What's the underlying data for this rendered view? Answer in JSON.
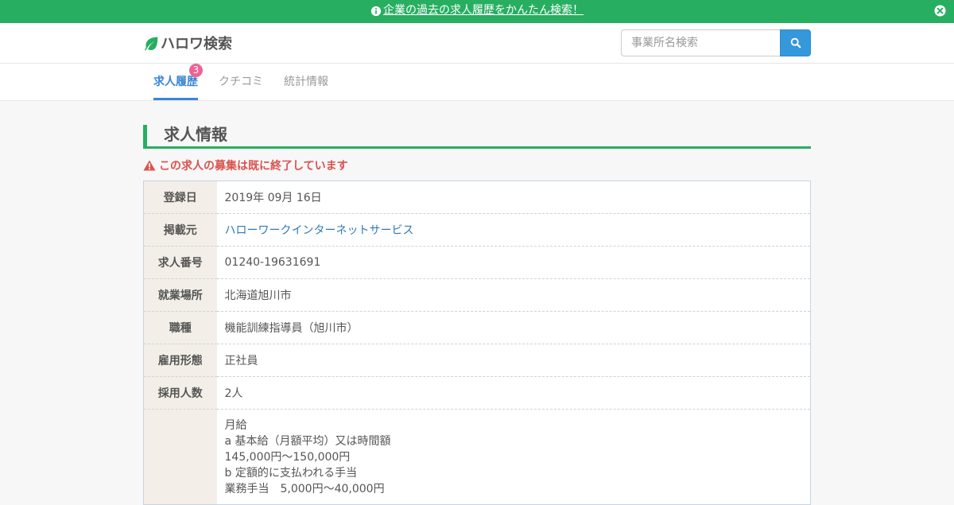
{
  "notice": {
    "link_text": "企業の過去の求人履歴をかんたん検索！"
  },
  "header": {
    "logo_text": "ハロワ検索",
    "search_placeholder": "事業所名検索"
  },
  "tabs": [
    {
      "label": "求人履歴",
      "active": true,
      "badge": "3"
    },
    {
      "label": "クチコミ",
      "active": false
    },
    {
      "label": "統計情報",
      "active": false
    }
  ],
  "section": {
    "title": "求人情報",
    "alert": "この求人の募集は既に終了しています"
  },
  "rows": [
    {
      "label": "登録日",
      "value": "2019年 09月 16日"
    },
    {
      "label": "掲載元",
      "value": "ハローワークインターネットサービス"
    },
    {
      "label": "求人番号",
      "value": "01240-19631691"
    },
    {
      "label": "就業場所",
      "value": "北海道旭川市"
    },
    {
      "label": "職種",
      "value": "機能訓練指導員（旭川市）"
    },
    {
      "label": "雇用形態",
      "value": "正社員"
    },
    {
      "label": "採用人数",
      "value": "2人"
    }
  ],
  "salary": {
    "label": "",
    "lines": [
      "月給",
      "a 基本給（月額平均）又は時間額",
      "145,000円～150,000円",
      "b 定額的に支払われる手当",
      "業務手当　5,000円～40,000円"
    ]
  },
  "colors": {
    "topbar": "#27ae60",
    "tab_active": "#3a86d6",
    "badge": "#f06292",
    "search_button": "#3498db",
    "alert": "#d9534f",
    "table_header_bg": "#f3efe8"
  },
  "icons": {
    "notice": "info-circle-icon",
    "close": "close-circle-icon",
    "logo": "leaf-icon",
    "search": "search-icon",
    "alert": "warning-triangle-icon"
  }
}
